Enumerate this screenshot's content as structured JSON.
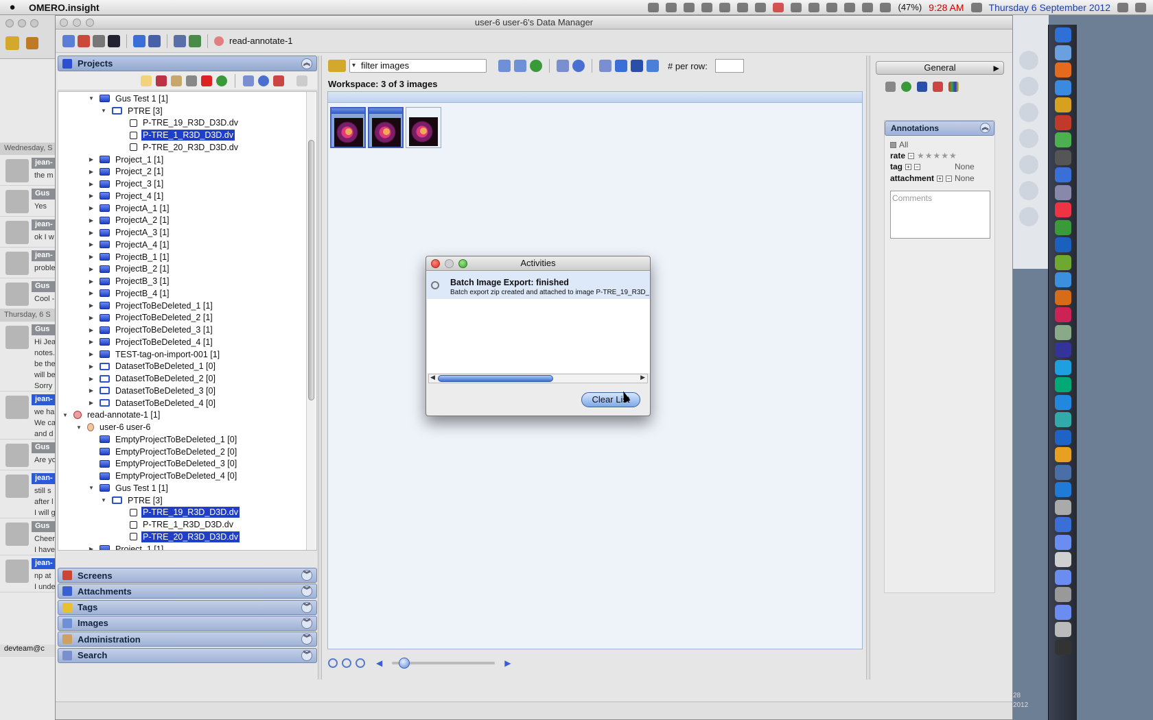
{
  "menubar": {
    "app_name": "OMERO.insight",
    "battery": "(47%)",
    "time": "9:28 AM",
    "date": "Thursday 6 September 2012"
  },
  "chat": {
    "day1": "Wednesday, S",
    "day2": "Thursday, 6 S",
    "messages": [
      {
        "name": "jean-",
        "text": "the m",
        "blue": false
      },
      {
        "name": "Gus",
        "text": "Yes",
        "blue": false
      },
      {
        "name": "jean-",
        "text": "ok I w",
        "blue": false
      },
      {
        "name": "jean-",
        "text": "proble",
        "blue": false
      },
      {
        "name": "Gus",
        "text": "Cool -",
        "blue": false
      }
    ],
    "messages2": [
      {
        "name": "Gus",
        "text": "Hi Jea\nnotes.\nbe the\nwill be\nSorry",
        "blue": false
      },
      {
        "name": "jean-",
        "text": "we ha\nWe ca\nand d",
        "blue": true
      },
      {
        "name": "Gus",
        "text": "Are yo",
        "blue": false
      },
      {
        "name": "jean-",
        "text": "still s\nafter l\nI will g",
        "blue": true
      },
      {
        "name": "Gus",
        "text": "Cheer\nI have",
        "blue": false
      },
      {
        "name": "jean-",
        "text": "np at\nI unde",
        "blue": true
      }
    ],
    "footer": "devteam@c"
  },
  "dock_clock": {
    "day": "28",
    "year": "2012"
  },
  "window": {
    "title": "user-6 user-6's Data Manager",
    "group_label": "read-annotate-1"
  },
  "projects_panel": {
    "title": "Projects",
    "tree": [
      {
        "label": "Gus Test 1 [1]",
        "type": "proj",
        "level": 2,
        "arrow": "down",
        "sel": false
      },
      {
        "label": "PTRE [3]",
        "type": "ds",
        "level": 3,
        "arrow": "down",
        "sel": false
      },
      {
        "label": "P-TRE_19_R3D_D3D.dv",
        "type": "img",
        "level": 4,
        "arrow": "",
        "sel": false
      },
      {
        "label": "P-TRE_1_R3D_D3D.dv",
        "type": "img",
        "level": 4,
        "arrow": "",
        "sel": true
      },
      {
        "label": "P-TRE_20_R3D_D3D.dv",
        "type": "img",
        "level": 4,
        "arrow": "",
        "sel": false
      },
      {
        "label": "Project_1 [1]",
        "type": "proj",
        "level": 2,
        "arrow": "right",
        "sel": false
      },
      {
        "label": "Project_2 [1]",
        "type": "proj",
        "level": 2,
        "arrow": "right",
        "sel": false
      },
      {
        "label": "Project_3 [1]",
        "type": "proj",
        "level": 2,
        "arrow": "right",
        "sel": false
      },
      {
        "label": "Project_4 [1]",
        "type": "proj",
        "level": 2,
        "arrow": "right",
        "sel": false
      },
      {
        "label": "ProjectA_1 [1]",
        "type": "proj",
        "level": 2,
        "arrow": "right",
        "sel": false
      },
      {
        "label": "ProjectA_2 [1]",
        "type": "proj",
        "level": 2,
        "arrow": "right",
        "sel": false
      },
      {
        "label": "ProjectA_3 [1]",
        "type": "proj",
        "level": 2,
        "arrow": "right",
        "sel": false
      },
      {
        "label": "ProjectA_4 [1]",
        "type": "proj",
        "level": 2,
        "arrow": "right",
        "sel": false
      },
      {
        "label": "ProjectB_1 [1]",
        "type": "proj",
        "level": 2,
        "arrow": "right",
        "sel": false
      },
      {
        "label": "ProjectB_2 [1]",
        "type": "proj",
        "level": 2,
        "arrow": "right",
        "sel": false
      },
      {
        "label": "ProjectB_3 [1]",
        "type": "proj",
        "level": 2,
        "arrow": "right",
        "sel": false
      },
      {
        "label": "ProjectB_4 [1]",
        "type": "proj",
        "level": 2,
        "arrow": "right",
        "sel": false
      },
      {
        "label": "ProjectToBeDeleted_1 [1]",
        "type": "proj",
        "level": 2,
        "arrow": "right",
        "sel": false
      },
      {
        "label": "ProjectToBeDeleted_2 [1]",
        "type": "proj",
        "level": 2,
        "arrow": "right",
        "sel": false
      },
      {
        "label": "ProjectToBeDeleted_3 [1]",
        "type": "proj",
        "level": 2,
        "arrow": "right",
        "sel": false
      },
      {
        "label": "ProjectToBeDeleted_4 [1]",
        "type": "proj",
        "level": 2,
        "arrow": "right",
        "sel": false
      },
      {
        "label": "TEST-tag-on-import-001 [1]",
        "type": "proj",
        "level": 2,
        "arrow": "right",
        "sel": false
      },
      {
        "label": "DatasetToBeDeleted_1 [0]",
        "type": "ds",
        "level": 2,
        "arrow": "right",
        "sel": false
      },
      {
        "label": "DatasetToBeDeleted_2 [0]",
        "type": "ds",
        "level": 2,
        "arrow": "right",
        "sel": false
      },
      {
        "label": "DatasetToBeDeleted_3 [0]",
        "type": "ds",
        "level": 2,
        "arrow": "right",
        "sel": false
      },
      {
        "label": "DatasetToBeDeleted_4 [0]",
        "type": "ds",
        "level": 2,
        "arrow": "right",
        "sel": false
      },
      {
        "label": "read-annotate-1 [1]",
        "type": "grp",
        "level": 0,
        "arrow": "down",
        "sel": false
      },
      {
        "label": "user-6 user-6",
        "type": "usr",
        "level": 1,
        "arrow": "down",
        "sel": false
      },
      {
        "label": "EmptyProjectToBeDeleted_1 [0]",
        "type": "proj",
        "level": 2,
        "arrow": "",
        "sel": false
      },
      {
        "label": "EmptyProjectToBeDeleted_2 [0]",
        "type": "proj",
        "level": 2,
        "arrow": "",
        "sel": false
      },
      {
        "label": "EmptyProjectToBeDeleted_3 [0]",
        "type": "proj",
        "level": 2,
        "arrow": "",
        "sel": false
      },
      {
        "label": "EmptyProjectToBeDeleted_4 [0]",
        "type": "proj",
        "level": 2,
        "arrow": "",
        "sel": false
      },
      {
        "label": "Gus Test 1 [1]",
        "type": "proj",
        "level": 2,
        "arrow": "down",
        "sel": false
      },
      {
        "label": "PTRE [3]",
        "type": "ds",
        "level": 3,
        "arrow": "down",
        "sel": false
      },
      {
        "label": "P-TRE_19_R3D_D3D.dv",
        "type": "img",
        "level": 4,
        "arrow": "",
        "sel": true
      },
      {
        "label": "P-TRE_1_R3D_D3D.dv",
        "type": "img",
        "level": 4,
        "arrow": "",
        "sel": false
      },
      {
        "label": "P-TRE_20_R3D_D3D.dv",
        "type": "img",
        "level": 4,
        "arrow": "",
        "sel": true
      },
      {
        "label": "Project_1 [1]",
        "type": "proj",
        "level": 2,
        "arrow": "right",
        "sel": false
      }
    ]
  },
  "accordions": [
    "Screens",
    "Attachments",
    "Tags",
    "Images",
    "Administration",
    "Search"
  ],
  "center": {
    "filter_text": "filter  images",
    "per_row_label": "# per row:",
    "workspace_label": "Workspace: 3 of 3 images"
  },
  "right_panel": {
    "tab": "General",
    "annotations_title": "Annotations",
    "all_label": "All",
    "rate_label": "rate",
    "tag_label": "tag",
    "tag_value": "None",
    "attachment_label": "attachment",
    "attachment_value": "None",
    "comments_placeholder": "Comments"
  },
  "activities": {
    "title": "Activities",
    "item_title": "Batch Image Export: finished",
    "item_detail": "Batch export zip created and attached to image P-TRE_19_R3D_",
    "clear_button": "Clear List"
  }
}
